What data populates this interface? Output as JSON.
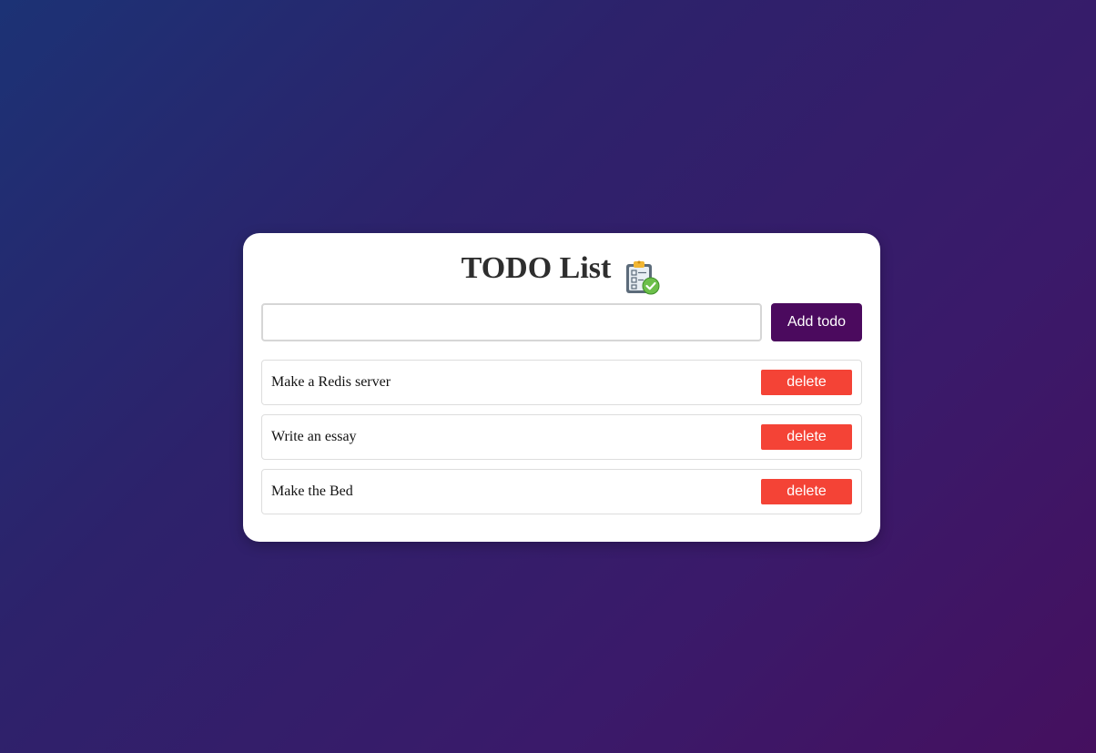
{
  "app": {
    "title": "TODO List",
    "title_icon": "clipboard-check-icon"
  },
  "input": {
    "value": "",
    "placeholder": ""
  },
  "add_button": {
    "label": "Add todo"
  },
  "todos": [
    {
      "text": "Make a Redis server",
      "delete_label": "delete"
    },
    {
      "text": "Write an essay",
      "delete_label": "delete"
    },
    {
      "text": "Make the Bed",
      "delete_label": "delete"
    }
  ],
  "colors": {
    "background_start": "#1c3275",
    "background_end": "#45105f",
    "card": "#ffffff",
    "add_button": "#4b0a5e",
    "delete_button": "#f44336",
    "title_text": "#2e2e2e"
  }
}
